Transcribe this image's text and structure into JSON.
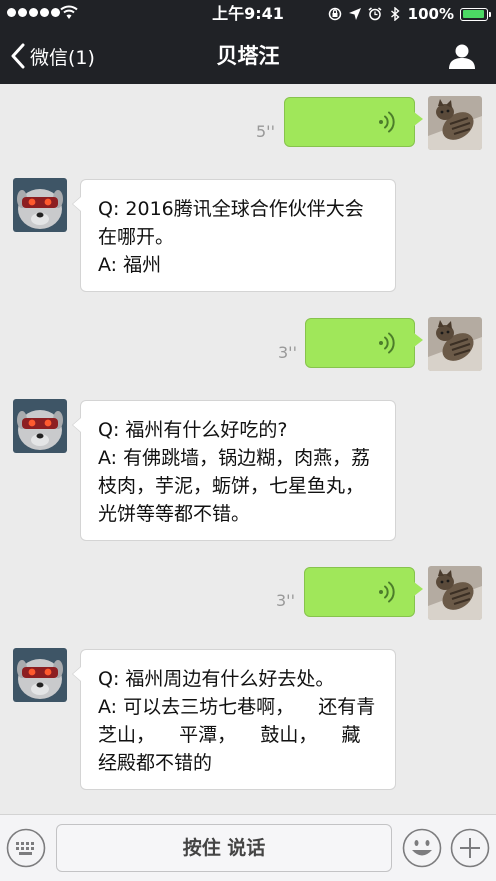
{
  "status_bar": {
    "time": "上午9:41",
    "battery_percent": "100%",
    "battery_level": 1.0,
    "signal_dots": 5,
    "icons": [
      "signal-dots-icon",
      "wifi-icon",
      "orientation-lock-icon",
      "location-arrow-icon",
      "alarm-icon",
      "bluetooth-icon",
      "battery-icon"
    ]
  },
  "nav": {
    "back_label": "微信(1)",
    "title": "贝塔汪",
    "back_icon": "chevron-left-icon",
    "profile_icon": "person-icon"
  },
  "messages": [
    {
      "type": "voice",
      "from": "me",
      "duration": "5''",
      "avatar": "cat-avatar"
    },
    {
      "type": "text",
      "from": "bot",
      "question": "Q: 2016腾讯全球合作伙伴大会在哪开。",
      "answer": "A: 福州",
      "avatar": "robot-dog-avatar"
    },
    {
      "type": "voice",
      "from": "me",
      "duration": "3''",
      "avatar": "cat-avatar"
    },
    {
      "type": "text",
      "from": "bot",
      "question": "Q: 福州有什么好吃的?",
      "answer": "A: 有佛跳墙，锅边糊，肉燕，荔枝肉，芋泥，蛎饼，七星鱼丸，光饼等等都不错。",
      "avatar": "robot-dog-avatar"
    },
    {
      "type": "voice",
      "from": "me",
      "duration": "3''",
      "avatar": "cat-avatar"
    },
    {
      "type": "text",
      "from": "bot",
      "question": "Q: 福州周边有什么好去处。",
      "answer": "A: 可以去三坊七巷啊，    还有青芝山，    平潭，    鼓山，    藏经殿都不错的",
      "avatar": "robot-dog-avatar"
    }
  ],
  "input_bar": {
    "talk_label": "按住 说话",
    "icons": [
      "keyboard-icon",
      "emoji-icon",
      "plus-icon"
    ]
  },
  "colors": {
    "bar_background": "#202226",
    "chat_background": "#ebebeb",
    "voice_bubble": "#a0e75a",
    "text_bubble": "#ffffff",
    "battery_fill": "#4cd964"
  }
}
